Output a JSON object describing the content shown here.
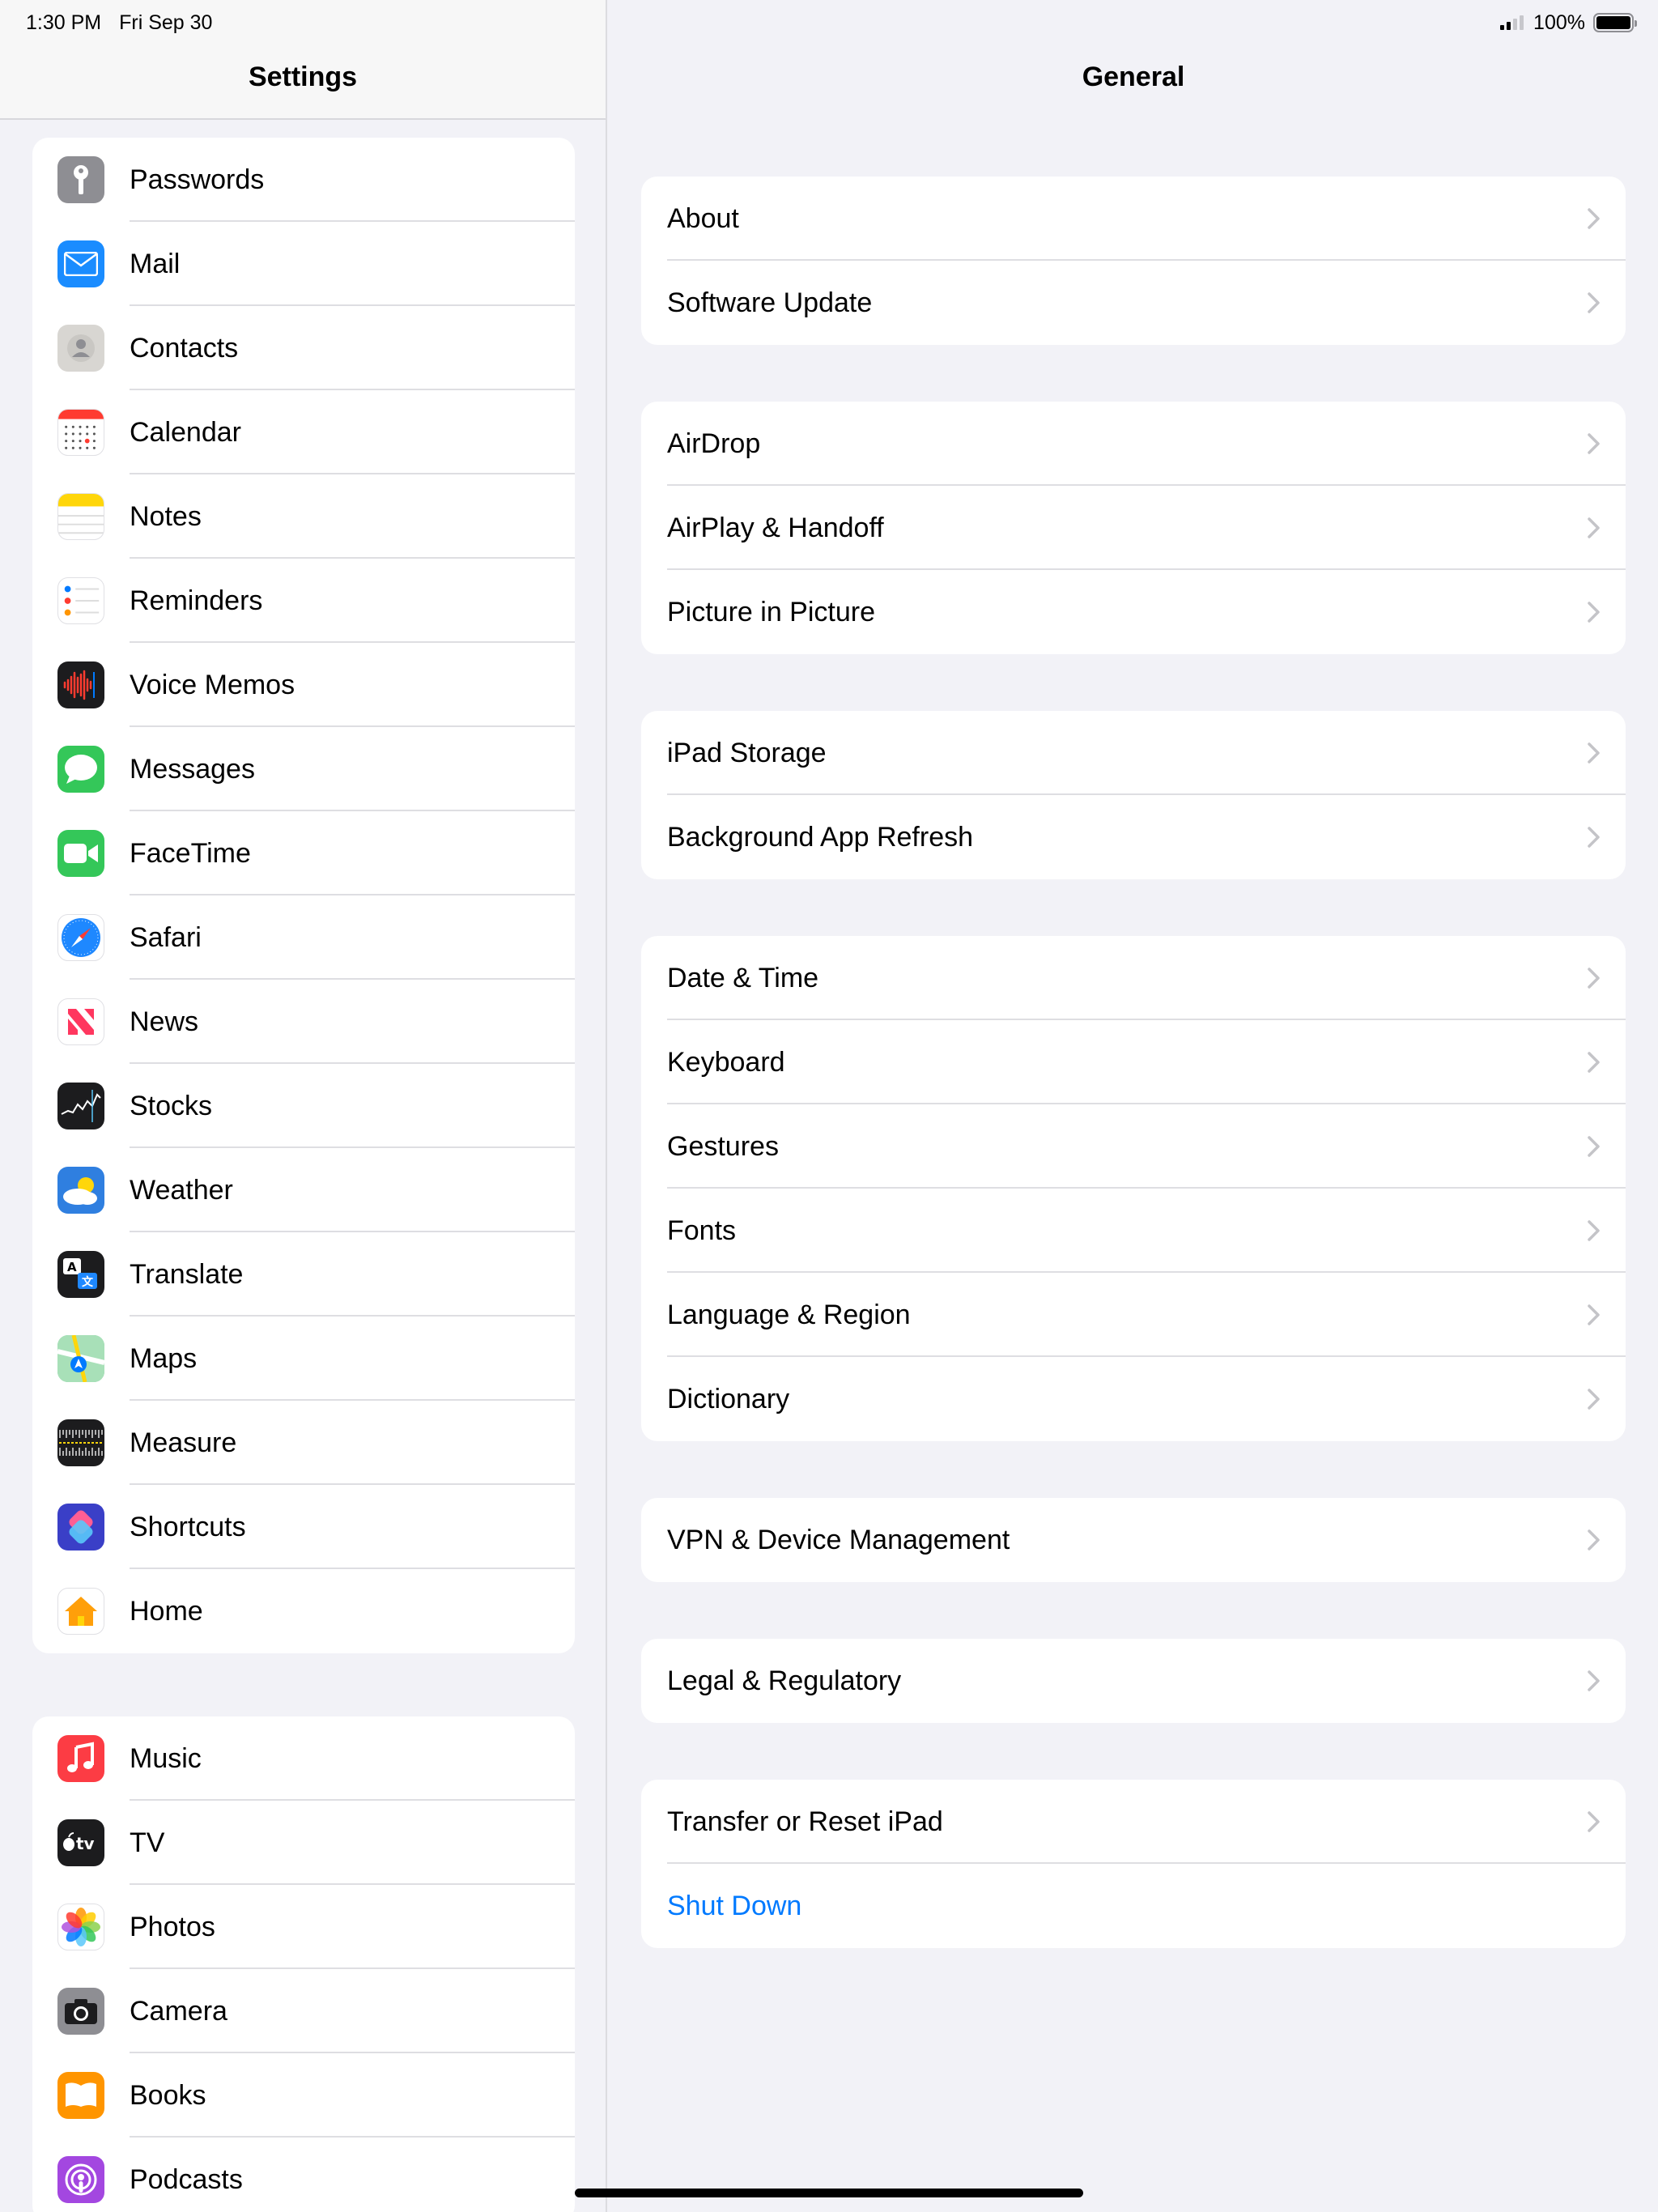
{
  "status_bar": {
    "time": "1:30 PM",
    "date": "Fri Sep 30",
    "battery": "100%"
  },
  "sidebar": {
    "title": "Settings",
    "groups": [
      [
        {
          "label": "Passwords",
          "icon": "key-icon",
          "color": "#8e8e93"
        },
        {
          "label": "Mail",
          "icon": "envelope-icon",
          "color": "#1a8cff"
        },
        {
          "label": "Contacts",
          "icon": "contacts-icon",
          "color": "#d8d6d2"
        },
        {
          "label": "Calendar",
          "icon": "calendar-icon",
          "color": "#ffffff"
        },
        {
          "label": "Notes",
          "icon": "notes-icon",
          "color": "#ffffff"
        },
        {
          "label": "Reminders",
          "icon": "reminders-icon",
          "color": "#ffffff"
        },
        {
          "label": "Voice Memos",
          "icon": "waveform-icon",
          "color": "#1c1c1e"
        },
        {
          "label": "Messages",
          "icon": "message-bubble-icon",
          "color": "#34c759"
        },
        {
          "label": "FaceTime",
          "icon": "video-camera-icon",
          "color": "#34c759"
        },
        {
          "label": "Safari",
          "icon": "compass-icon",
          "color": "#ffffff"
        },
        {
          "label": "News",
          "icon": "news-icon",
          "color": "#ffffff"
        },
        {
          "label": "Stocks",
          "icon": "stocks-chart-icon",
          "color": "#1c1c1e"
        },
        {
          "label": "Weather",
          "icon": "weather-cloud-sun-icon",
          "color": "#2f7fe0"
        },
        {
          "label": "Translate",
          "icon": "translate-icon",
          "color": "#1c1c1e"
        },
        {
          "label": "Maps",
          "icon": "map-icon",
          "color": "#7ed0a0"
        },
        {
          "label": "Measure",
          "icon": "ruler-icon",
          "color": "#1c1c1e"
        },
        {
          "label": "Shortcuts",
          "icon": "shortcuts-icon",
          "color": "#3a3fc7"
        },
        {
          "label": "Home",
          "icon": "house-icon",
          "color": "#ffffff"
        }
      ],
      [
        {
          "label": "Music",
          "icon": "music-note-icon",
          "color": "#fc3c44"
        },
        {
          "label": "TV",
          "icon": "apple-tv-icon",
          "color": "#1c1c1e"
        },
        {
          "label": "Photos",
          "icon": "photos-flower-icon",
          "color": "#ffffff"
        },
        {
          "label": "Camera",
          "icon": "camera-icon",
          "color": "#8e8e93"
        },
        {
          "label": "Books",
          "icon": "book-icon",
          "color": "#ff9500"
        },
        {
          "label": "Podcasts",
          "icon": "podcast-icon",
          "color": "#a347e0"
        }
      ]
    ]
  },
  "detail": {
    "title": "General",
    "groups": [
      [
        {
          "label": "About"
        },
        {
          "label": "Software Update"
        }
      ],
      [
        {
          "label": "AirDrop"
        },
        {
          "label": "AirPlay & Handoff"
        },
        {
          "label": "Picture in Picture"
        }
      ],
      [
        {
          "label": "iPad Storage"
        },
        {
          "label": "Background App Refresh"
        }
      ],
      [
        {
          "label": "Date & Time"
        },
        {
          "label": "Keyboard"
        },
        {
          "label": "Gestures"
        },
        {
          "label": "Fonts"
        },
        {
          "label": "Language & Region"
        },
        {
          "label": "Dictionary"
        }
      ],
      [
        {
          "label": "VPN & Device Management"
        }
      ],
      [
        {
          "label": "Legal & Regulatory"
        }
      ],
      [
        {
          "label": "Transfer or Reset iPad"
        },
        {
          "label": "Shut Down",
          "link": true
        }
      ]
    ]
  },
  "colors": {
    "accent": "#007aff",
    "background": "#f2f2f7",
    "separator": "#dedee2"
  }
}
